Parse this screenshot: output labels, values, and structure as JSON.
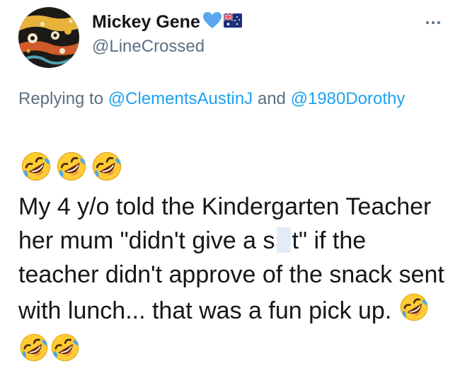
{
  "author": {
    "display_name": "Mickey Gene",
    "handle": "@LineCrossed",
    "badges": [
      "blue-heart-icon",
      "australia-flag-icon"
    ],
    "avatar": "aboriginal-art-avatar"
  },
  "more_icon": "more-options-icon",
  "reply": {
    "prefix": "Replying to ",
    "mention_1": "@ClementsAustinJ",
    "joiner": " and ",
    "mention_2": "@1980Dorothy"
  },
  "emoji_name": "rolling-on-the-floor-laughing-emoji",
  "tweet": {
    "leading_emoji_count": 3,
    "text_part_1": "My 4 y/o told the Kindergarten Teacher her mum \"didn't give a s",
    "text_part_2": "t\" if the teacher didn't approve of the snack sent with lunch... that was a fun pick up. ",
    "trailing_emoji_count": 3
  },
  "colors": {
    "link": "#1da1f2",
    "secondary_text": "#5b7083",
    "primary_text": "#14171a",
    "censor_box": "#e3ecf6",
    "heart": "#5aa7f0"
  }
}
